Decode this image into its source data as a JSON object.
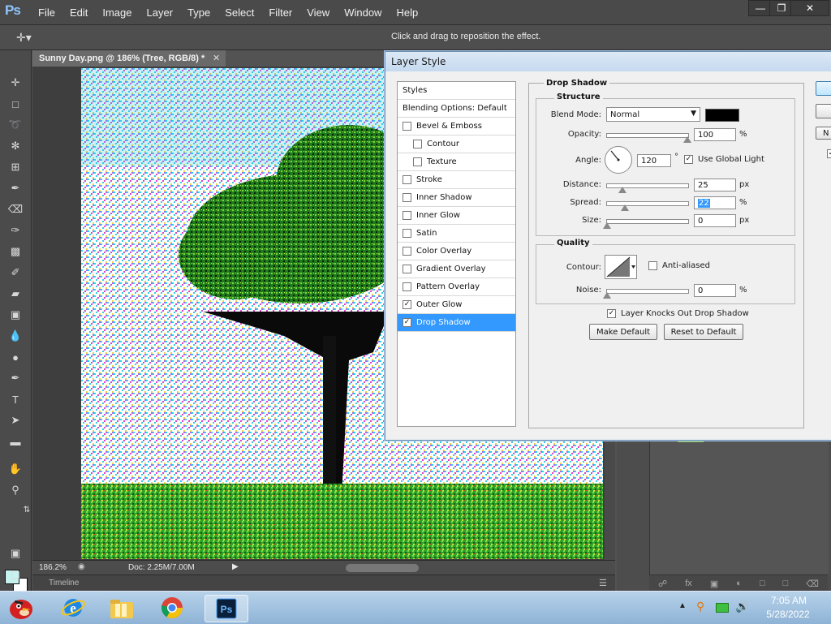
{
  "app": {
    "logo": "Ps"
  },
  "menu": [
    "File",
    "Edit",
    "Image",
    "Layer",
    "Type",
    "Select",
    "Filter",
    "View",
    "Window",
    "Help"
  ],
  "options_bar": {
    "hint": "Click and drag to reposition the effect."
  },
  "document": {
    "tab_title": "Sunny Day.png @ 186% (Tree, RGB/8) *",
    "zoom": "186.2%",
    "doc_info": "Doc: 2.25M/7.00M",
    "timeline_label": "Timeline"
  },
  "dialog": {
    "title": "Layer Style",
    "styles_list": {
      "header": "Styles",
      "blending": "Blending Options: Default",
      "items": [
        {
          "label": "Bevel & Emboss",
          "checked": false,
          "indent": false,
          "selected": false
        },
        {
          "label": "Contour",
          "checked": false,
          "indent": true,
          "selected": false
        },
        {
          "label": "Texture",
          "checked": false,
          "indent": true,
          "selected": false
        },
        {
          "label": "Stroke",
          "checked": false,
          "indent": false,
          "selected": false
        },
        {
          "label": "Inner Shadow",
          "checked": false,
          "indent": false,
          "selected": false
        },
        {
          "label": "Inner Glow",
          "checked": false,
          "indent": false,
          "selected": false
        },
        {
          "label": "Satin",
          "checked": false,
          "indent": false,
          "selected": false
        },
        {
          "label": "Color Overlay",
          "checked": false,
          "indent": false,
          "selected": false
        },
        {
          "label": "Gradient Overlay",
          "checked": false,
          "indent": false,
          "selected": false
        },
        {
          "label": "Pattern Overlay",
          "checked": false,
          "indent": false,
          "selected": false
        },
        {
          "label": "Outer Glow",
          "checked": true,
          "indent": false,
          "selected": false
        },
        {
          "label": "Drop Shadow",
          "checked": true,
          "indent": false,
          "selected": true
        }
      ]
    },
    "drop_shadow": {
      "title": "Drop Shadow",
      "structure_title": "Structure",
      "blend_mode_label": "Blend Mode:",
      "blend_mode": "Normal",
      "shadow_color": "#000000",
      "opacity_label": "Opacity:",
      "opacity": "100",
      "angle_label": "Angle:",
      "angle": "120",
      "angle_unit": "°",
      "use_global_light": "Use Global Light",
      "use_global_light_checked": true,
      "distance_label": "Distance:",
      "distance": "25",
      "spread_label": "Spread:",
      "spread": "22",
      "size_label": "Size:",
      "size": "0",
      "unit_percent": "%",
      "unit_px": "px",
      "quality_title": "Quality",
      "contour_label": "Contour:",
      "anti_aliased": "Anti-aliased",
      "noise_label": "Noise:",
      "noise": "0",
      "layer_knocks_out": "Layer Knocks Out Drop Shadow",
      "make_default": "Make Default",
      "reset_default": "Reset to Default"
    },
    "side_button_partial": "N"
  },
  "taskbar": {
    "time": "7:05 AM",
    "date": "5/28/2022"
  }
}
